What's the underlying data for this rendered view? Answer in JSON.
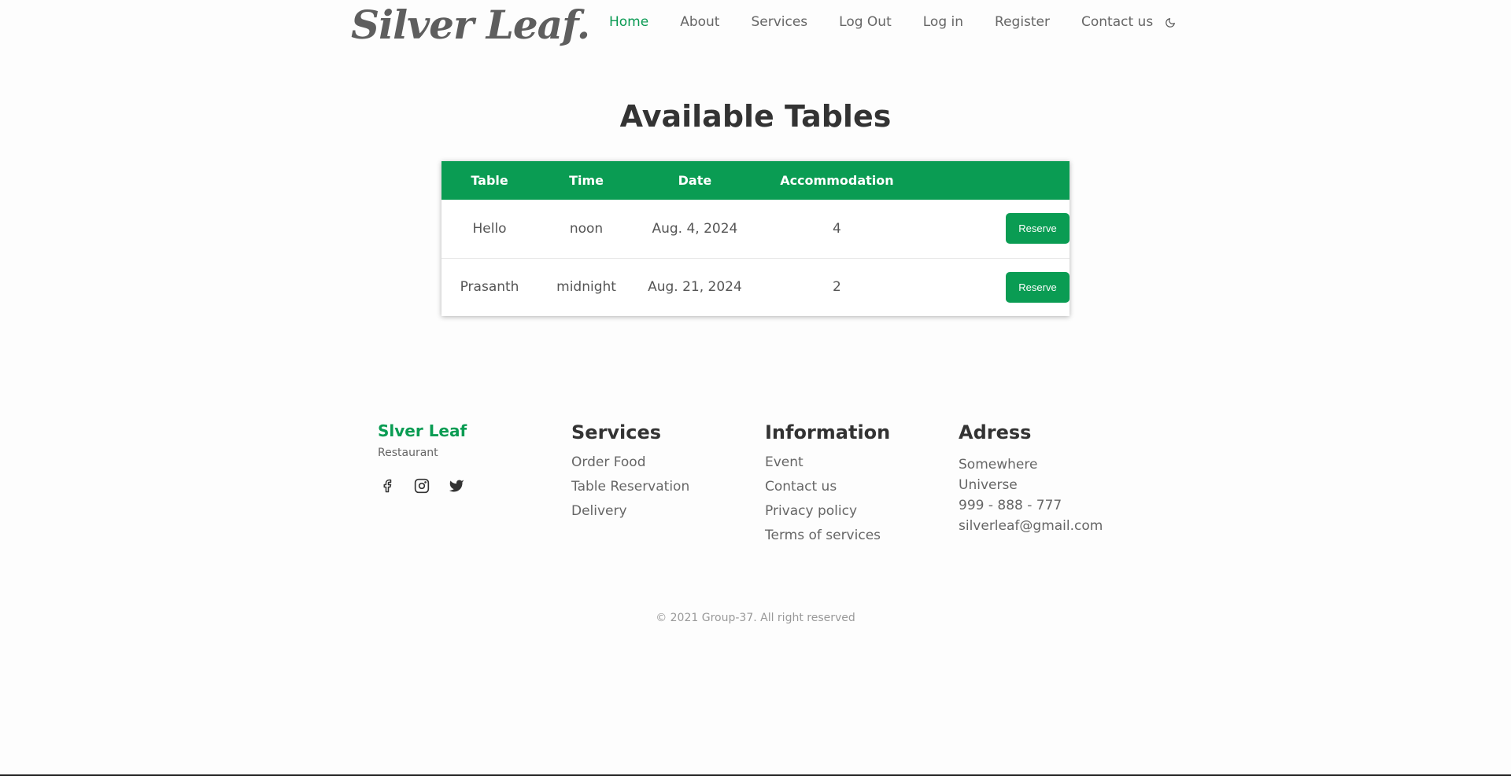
{
  "header": {
    "logo": "Silver Leaf.",
    "nav": [
      "Home",
      "About",
      "Services",
      "Log Out",
      "Log in",
      "Register",
      "Contact us"
    ],
    "active": "Home",
    "theme_icon": "moon-icon"
  },
  "main": {
    "title": "Available Tables",
    "table": {
      "columns": [
        "Table",
        "Time",
        "Date",
        "Accommodation",
        ""
      ],
      "rows": [
        {
          "table": "Hello",
          "time": "noon",
          "date": "Aug. 4, 2024",
          "accommodation": "4",
          "action": "Reserve"
        },
        {
          "table": "Prasanth",
          "time": "midnight",
          "date": "Aug. 21, 2024",
          "accommodation": "2",
          "action": "Reserve"
        }
      ]
    }
  },
  "footer": {
    "brand": {
      "name": "Slver Leaf",
      "subtitle": "Restaurant"
    },
    "socials": [
      "facebook-icon",
      "instagram-icon",
      "twitter-icon"
    ],
    "services": {
      "heading": "Services",
      "links": [
        "Order Food",
        "Table Reservation",
        "Delivery"
      ]
    },
    "information": {
      "heading": "Information",
      "links": [
        "Event",
        "Contact us",
        "Privacy policy",
        "Terms of services"
      ]
    },
    "address": {
      "heading": "Adress",
      "lines": [
        "Somewhere",
        "Universe",
        "999 - 888 - 777",
        "silverleaf@gmail.com"
      ]
    },
    "copyright": "© 2021 Group-37. All right reserved"
  },
  "colors": {
    "accent": "#0a9c53",
    "text": "#555555",
    "heading": "#333333"
  }
}
